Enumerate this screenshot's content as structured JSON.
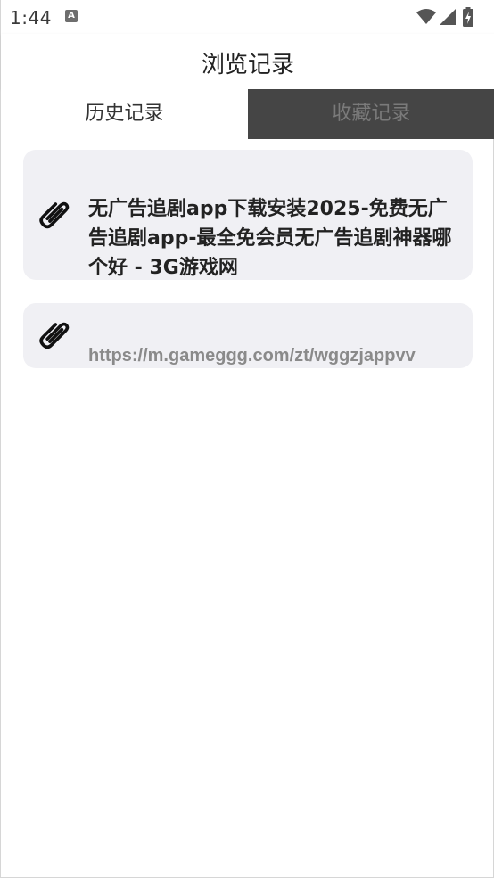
{
  "status_bar": {
    "time": "1:44",
    "notification_icon_letter": "A",
    "icons": [
      "wifi-icon",
      "signal-icon",
      "battery-charging-icon"
    ]
  },
  "header": {
    "title": "浏览记录"
  },
  "tabs": [
    {
      "label": "历史记录",
      "active": true
    },
    {
      "label": "收藏记录",
      "active": false
    }
  ],
  "history": [
    {
      "icon": "paperclip-icon",
      "title": "无广告追剧app下载安装2025-免费无广告追剧app-最全免会员无广告追剧神器哪个好 - 3G游戏网",
      "url": ""
    },
    {
      "icon": "paperclip-icon",
      "title": "",
      "url": "https://m.gameggg.com/zt/wggzjappvv"
    }
  ],
  "colors": {
    "card_background": "#f0f0f4",
    "inactive_tab_background": "#454545",
    "url_text": "#8a8a8a"
  }
}
